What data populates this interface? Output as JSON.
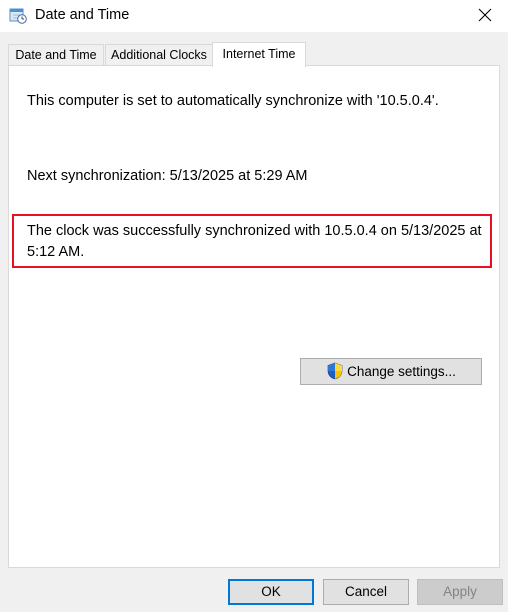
{
  "window": {
    "title": "Date and Time",
    "title_icon": "calendar-clock-icon",
    "close_icon": "close-icon"
  },
  "tabs": [
    {
      "label": "Date and Time",
      "active": false
    },
    {
      "label": "Additional Clocks",
      "active": false
    },
    {
      "label": "Internet Time",
      "active": true
    }
  ],
  "internet_time": {
    "auto_sync_text": "This computer is set to automatically synchronize with '10.5.0.4'.",
    "next_sync_text": "Next synchronization: 5/13/2025 at 5:29 AM",
    "status_line1": "The clock was successfully synchronized with 10.5.0.4 on 5/13/2025 at",
    "status_line2": "5:12 AM.",
    "change_settings_label": "Change settings...",
    "change_settings_icon": "uac-shield-icon"
  },
  "footer": {
    "ok_label": "OK",
    "cancel_label": "Cancel",
    "apply_label": "Apply"
  },
  "colors": {
    "highlight_border": "#e81123",
    "primary_button_border": "#0078d7"
  }
}
